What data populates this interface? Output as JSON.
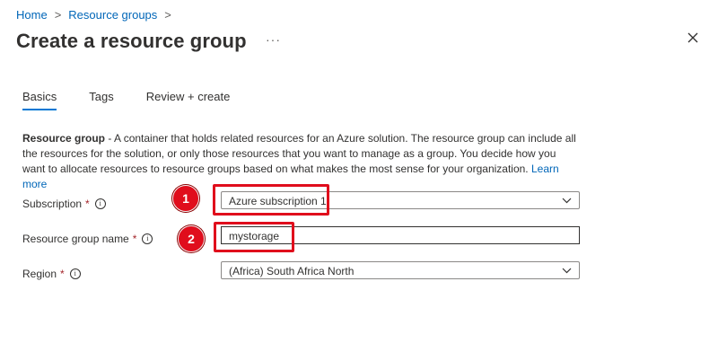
{
  "breadcrumb": {
    "items": [
      "Home",
      "Resource groups"
    ]
  },
  "page": {
    "title": "Create a resource group",
    "more_label": "···"
  },
  "tabs": [
    {
      "label": "Basics",
      "active": true
    },
    {
      "label": "Tags",
      "active": false
    },
    {
      "label": "Review + create",
      "active": false
    }
  ],
  "description": {
    "bold": "Resource group",
    "text": " - A container that holds related resources for an Azure solution. The resource group can include all the resources for the solution, or only those resources that you want to manage as a group. You decide how you want to allocate resources to resource groups based on what makes the most sense for your organization. ",
    "link": "Learn more"
  },
  "form": {
    "subscription": {
      "label": "Subscription",
      "required": "*",
      "value": "Azure subscription 1"
    },
    "resource_group_name": {
      "label": "Resource group name",
      "required": "*",
      "value": "mystorage"
    },
    "region": {
      "label": "Region",
      "required": "*",
      "value": "(Africa) South Africa North"
    }
  },
  "annotations": {
    "badge1": "1",
    "badge2": "2"
  },
  "colors": {
    "accent": "#0078d4",
    "link": "#0066b8",
    "callout": "#e00d1c",
    "required": "#a4262c"
  },
  "icons": {
    "close": "close-icon",
    "info": "info-icon",
    "chevron": "chevron-down-icon"
  }
}
